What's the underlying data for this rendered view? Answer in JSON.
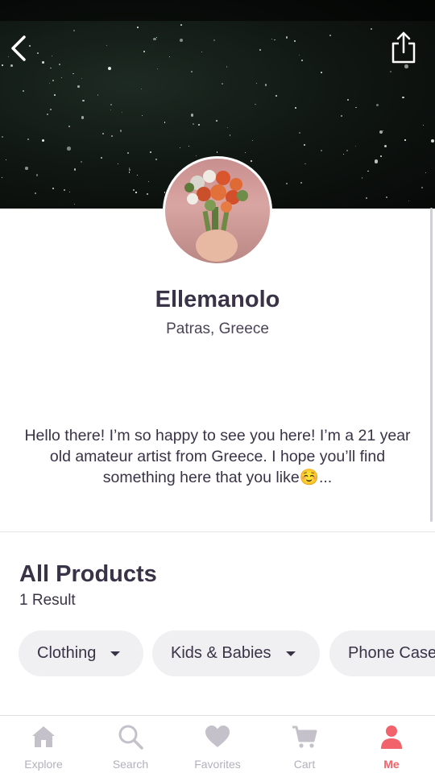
{
  "header": {
    "back_icon": "chevron-left-icon",
    "share_icon": "share-icon"
  },
  "profile": {
    "name": "Ellemanolo",
    "location": "Patras, Greece",
    "bio": "Hello there! I’m so happy to see you here! I’m a 21 year old amateur artist from Greece. I hope you’ll find something here that you like☺️..."
  },
  "products": {
    "title": "All Products",
    "result_count": "1 Result",
    "filters": [
      {
        "label": "Clothing"
      },
      {
        "label": "Kids & Babies"
      },
      {
        "label": "Phone Case"
      }
    ]
  },
  "tabbar": {
    "items": [
      {
        "label": "Explore",
        "icon": "home-icon"
      },
      {
        "label": "Search",
        "icon": "search-icon"
      },
      {
        "label": "Favorites",
        "icon": "heart-icon"
      },
      {
        "label": "Cart",
        "icon": "cart-icon"
      },
      {
        "label": "Me",
        "icon": "person-icon"
      }
    ],
    "active_color": "#f2626a",
    "inactive_color": "#b3b0bb"
  }
}
